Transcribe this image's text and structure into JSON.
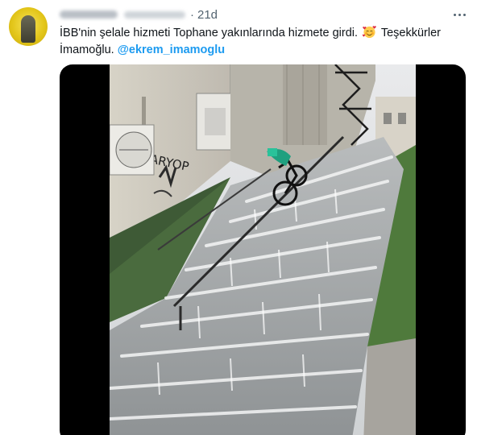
{
  "tweet": {
    "author_name": "",
    "author_handle": "",
    "separator": "·",
    "time_ago": "21d",
    "text_part1": "İBB'nin şelale hizmeti Tophane yakınlarında hizmete girdi.",
    "text_part2": "Teşekkürler İmamoğlu.",
    "mention": "@ekrem_imamoglu",
    "emoji": "smiling-face-with-hearts-emoji"
  },
  "media": {
    "kind": "video-thumbnail",
    "graffiti_text": "KARYOP"
  },
  "colors": {
    "link": "#1d9bf0",
    "secondary_text": "#536471",
    "text": "#0f1419",
    "media_background": "#000000"
  },
  "icons": {
    "more_menu": "more-horizontal-icon"
  }
}
